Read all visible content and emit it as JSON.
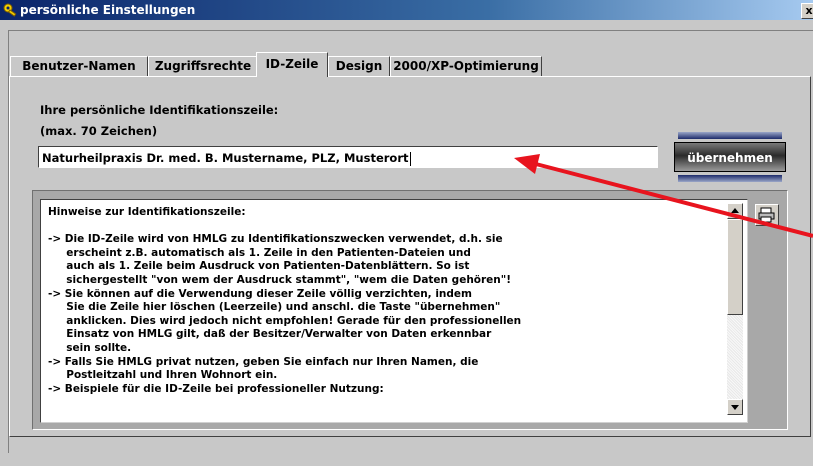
{
  "window": {
    "title": "persönliche Einstellungen",
    "close_label": "x"
  },
  "tabs": [
    {
      "label": "Benutzer-Namen",
      "active": false
    },
    {
      "label": "Zugriffsrechte",
      "active": false
    },
    {
      "label": "ID-Zeile",
      "active": true
    },
    {
      "label": "Design",
      "active": false
    },
    {
      "label": "2000/XP-Optimierung",
      "active": false
    }
  ],
  "id_line": {
    "label": "Ihre persönliche Identifikationszeile:",
    "limit_label": "(max. 70 Zeichen)",
    "value": "Naturheilpraxis Dr. med. B. Mustername, PLZ, Musterort",
    "apply_label": "übernehmen"
  },
  "hints": {
    "text": "Hinweise zur Identifikationszeile:\n\n-> Die ID-Zeile wird von HMLG zu Identifikationszwecken verwendet, d.h. sie\n     erscheint z.B. automatisch als 1. Zeile in den Patienten-Dateien und\n     auch als 1. Zeile beim Ausdruck von Patienten-Datenblättern. So ist\n     sichergestellt \"von wem der Ausdruck stammt\", \"wem die Daten gehören\"!\n-> Sie können auf die Verwendung dieser Zeile völlig verzichten, indem\n     Sie die Zeile hier löschen (Leerzeile) und anschl. die Taste \"übernehmen\"\n     anklicken. Dies wird jedoch nicht empfohlen! Gerade für den professionellen\n     Einsatz von HMLG gilt, daß der Besitzer/Verwalter von Daten erkennbar\n     sein sollte.\n-> Falls Sie HMLG privat nutzen, geben Sie einfach nur Ihren Namen, die\n     Postleitzahl und Ihren Wohnort ein.\n-> Beispiele für die ID-Zeile bei professioneller Nutzung:"
  },
  "icons": {
    "title": "key-icon",
    "print": "printer-icon",
    "scroll_up": "arrow-up-icon",
    "scroll_down": "arrow-down-icon"
  },
  "colors": {
    "annotation_arrow": "#e8141e",
    "titlebar": "#0a246a",
    "apply_button": "#2a2a2a"
  }
}
